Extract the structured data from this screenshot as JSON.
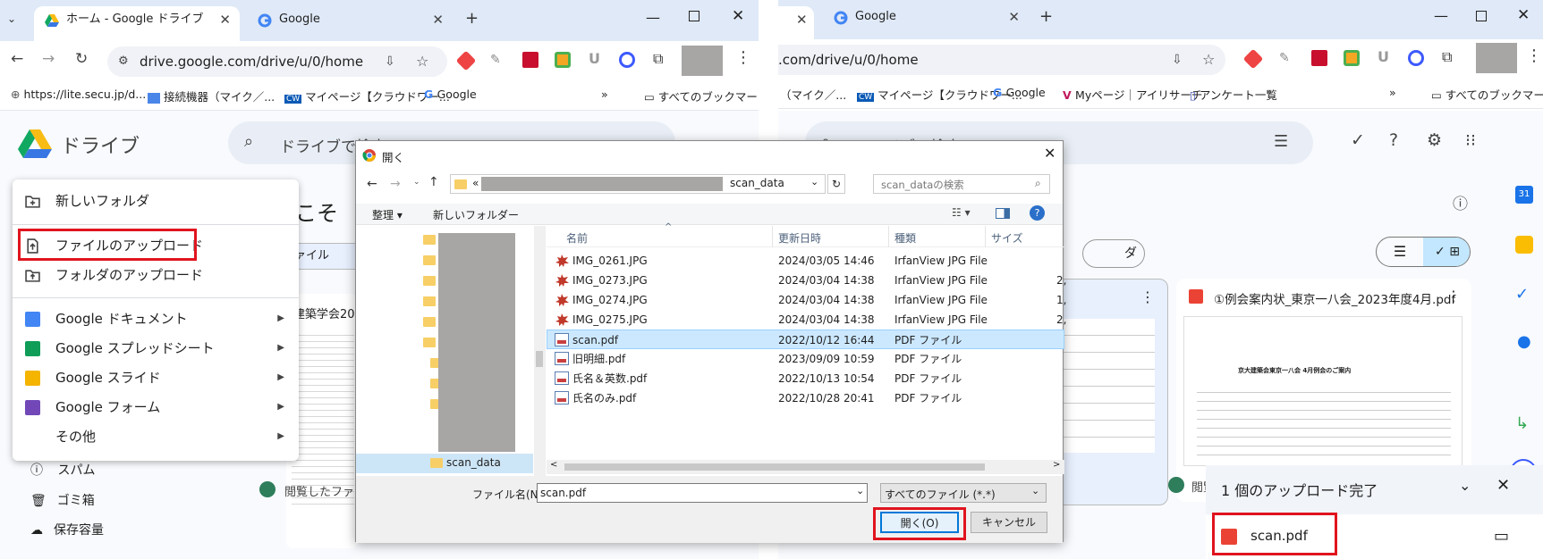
{
  "left": {
    "tabs": [
      {
        "title": "ホーム - Google ドライブ"
      },
      {
        "title": "Google"
      }
    ],
    "url": "drive.google.com/drive/u/0/home",
    "bookmarks": [
      {
        "label": "https://lite.secu.jp/d..."
      },
      {
        "label": "接続機器（マイク／..."
      },
      {
        "label": "マイページ【クラウドワー..."
      },
      {
        "label": "Google"
      }
    ],
    "all_bookmarks": "すべてのブックマーク",
    "drive_title": "ドライブ",
    "search_placeholder": "ドライブで検索",
    "bg_text": {
      "welcome": "こそ",
      "file_tab": "ァイル",
      "card_title": "建築学会20"
    },
    "new_menu": [
      {
        "label": "新しいフォルダ"
      },
      {
        "label": "ファイルのアップロード"
      },
      {
        "label": "フォルダのアップロード"
      },
      {
        "label": "Google ドキュメント"
      },
      {
        "label": "Google スプレッドシート"
      },
      {
        "label": "Google スライド"
      },
      {
        "label": "Google フォーム"
      },
      {
        "label": "その他"
      }
    ],
    "sidebar": [
      {
        "label": "スパム"
      },
      {
        "label": "ゴミ箱"
      },
      {
        "label": "保存容量"
      }
    ],
    "viewed_label": "閲覧したファイ"
  },
  "dialog": {
    "title": "開く",
    "path_prefix": "«",
    "path_folder": "scan_data",
    "search_placeholder": "scan_dataの検索",
    "organize": "整理 ▾",
    "new_folder": "新しいフォルダー",
    "tree_selected": "scan_data",
    "columns": {
      "name": "名前",
      "date": "更新日時",
      "type": "種類",
      "size": "サイズ"
    },
    "files": [
      {
        "name": "IMG_0261.JPG",
        "date": "2024/03/05 14:46",
        "type": "IrfanView JPG File",
        "size": "",
        "icon": "jpg"
      },
      {
        "name": "IMG_0273.JPG",
        "date": "2024/03/04 14:38",
        "type": "IrfanView JPG File",
        "size": "2,",
        "icon": "jpg"
      },
      {
        "name": "IMG_0274.JPG",
        "date": "2024/03/04 14:38",
        "type": "IrfanView JPG File",
        "size": "1,",
        "icon": "jpg"
      },
      {
        "name": "IMG_0275.JPG",
        "date": "2024/03/04 14:38",
        "type": "IrfanView JPG File",
        "size": "2,",
        "icon": "jpg"
      },
      {
        "name": "scan.pdf",
        "date": "2022/10/12 16:44",
        "type": "PDF ファイル",
        "size": "",
        "icon": "pdf"
      },
      {
        "name": "旧明細.pdf",
        "date": "2023/09/09 10:59",
        "type": "PDF ファイル",
        "size": "",
        "icon": "pdf"
      },
      {
        "name": "氏名＆英数.pdf",
        "date": "2022/10/13 10:54",
        "type": "PDF ファイル",
        "size": "",
        "icon": "pdf"
      },
      {
        "name": "氏名のみ.pdf",
        "date": "2022/10/28 20:41",
        "type": "PDF ファイル",
        "size": "",
        "icon": "pdf"
      }
    ],
    "filename_label": "ファイル名(N):",
    "filename_value": "scan.pdf",
    "filetype_value": "すべてのファイル (*.*)",
    "open_button": "開く(O)",
    "cancel_button": "キャンセル"
  },
  "right": {
    "tabs": [
      {
        "title": "Google"
      }
    ],
    "url": ".com/drive/u/0/home",
    "bookmarks": [
      {
        "label": "（マイク／..."
      },
      {
        "label": "マイページ【クラウドワー..."
      },
      {
        "label": "Google"
      },
      {
        "label": "Myページ｜アイリサーチ"
      },
      {
        "label": "アンケート一覧"
      }
    ],
    "all_bookmarks": "すべてのブックマーク",
    "search_placeholder": "ドライブで検索",
    "folder_chip": "ダ",
    "card_title": "①例会案内状_東京一八会_2023年度4月.pdf",
    "doc_heading": "京大建築会東京一八会 4月例会のご案内",
    "viewed_label": "閲覧",
    "upload_status": "1 個のアップロード完了",
    "uploaded_file": "scan.pdf"
  },
  "colors": {
    "accent_red": "#e0141e",
    "drive_blue": "#0b57d0",
    "selection": "#cce8ff"
  }
}
